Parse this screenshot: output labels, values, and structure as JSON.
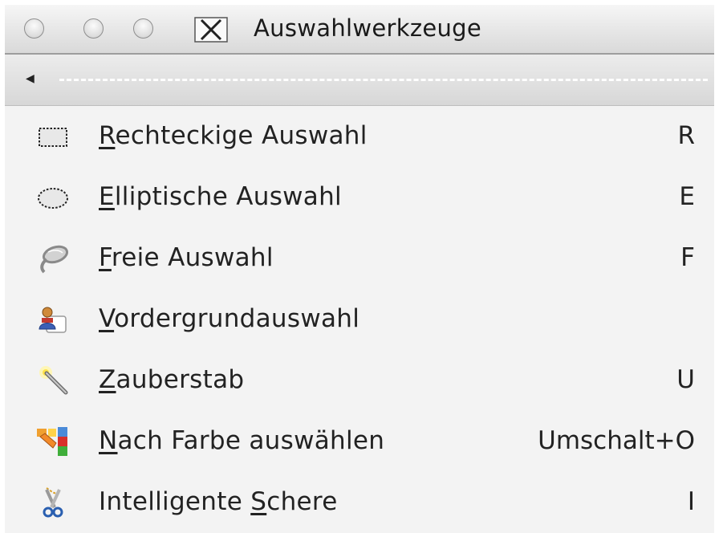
{
  "window": {
    "title": "Auswahlwerkzeuge"
  },
  "menu": {
    "items": [
      {
        "mnemonic": "R",
        "rest": "echteckige Auswahl",
        "shortcut": "R",
        "icon": "rect-select-icon"
      },
      {
        "mnemonic": "E",
        "rest": "lliptische Auswahl",
        "shortcut": "E",
        "icon": "ellipse-select-icon"
      },
      {
        "mnemonic": "F",
        "rest": "reie Auswahl",
        "shortcut": "F",
        "icon": "lasso-icon"
      },
      {
        "mnemonic": "V",
        "rest": "ordergrundauswahl",
        "shortcut": "",
        "icon": "foreground-select-icon"
      },
      {
        "mnemonic": "Z",
        "rest": "auberstab",
        "shortcut": "U",
        "icon": "magic-wand-icon"
      },
      {
        "mnemonic": "N",
        "rest": "ach Farbe auswählen",
        "shortcut": "Umschalt+O",
        "icon": "color-select-icon"
      },
      {
        "pre": "Intelligente ",
        "mnemonic": "S",
        "rest": "chere",
        "shortcut": "I",
        "icon": "scissors-icon"
      }
    ]
  }
}
